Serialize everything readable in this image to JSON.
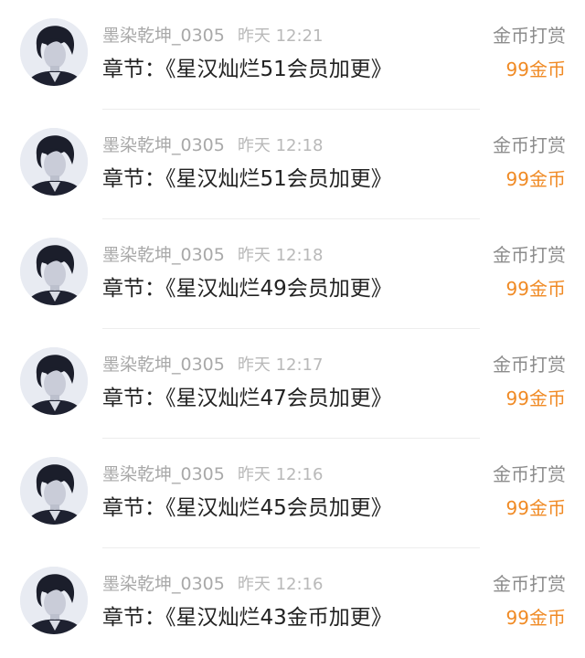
{
  "colors": {
    "username": "#a9a9a9",
    "time": "#b9b9b9",
    "chapter_text": "#222222",
    "action_text": "#8c8c8c",
    "amount_accent": "#f08a24",
    "divider": "#ededed"
  },
  "records": [
    {
      "username": "墨染乾坤_0305",
      "time": "昨天 12:21",
      "chapter": "章节：《星汉灿烂51会员加更》",
      "action": "金币打赏",
      "amount": "99金币",
      "avatar_icon": "user-avatar-icon"
    },
    {
      "username": "墨染乾坤_0305",
      "time": "昨天 12:18",
      "chapter": "章节：《星汉灿烂51会员加更》",
      "action": "金币打赏",
      "amount": "99金币",
      "avatar_icon": "user-avatar-icon"
    },
    {
      "username": "墨染乾坤_0305",
      "time": "昨天 12:18",
      "chapter": "章节：《星汉灿烂49会员加更》",
      "action": "金币打赏",
      "amount": "99金币",
      "avatar_icon": "user-avatar-icon"
    },
    {
      "username": "墨染乾坤_0305",
      "time": "昨天 12:17",
      "chapter": "章节：《星汉灿烂47会员加更》",
      "action": "金币打赏",
      "amount": "99金币",
      "avatar_icon": "user-avatar-icon"
    },
    {
      "username": "墨染乾坤_0305",
      "time": "昨天 12:16",
      "chapter": "章节：《星汉灿烂45会员加更》",
      "action": "金币打赏",
      "amount": "99金币",
      "avatar_icon": "user-avatar-icon"
    },
    {
      "username": "墨染乾坤_0305",
      "time": "昨天 12:16",
      "chapter": "章节：《星汉灿烂43金币加更》",
      "action": "金币打赏",
      "amount": "99金币",
      "avatar_icon": "user-avatar-icon"
    }
  ]
}
